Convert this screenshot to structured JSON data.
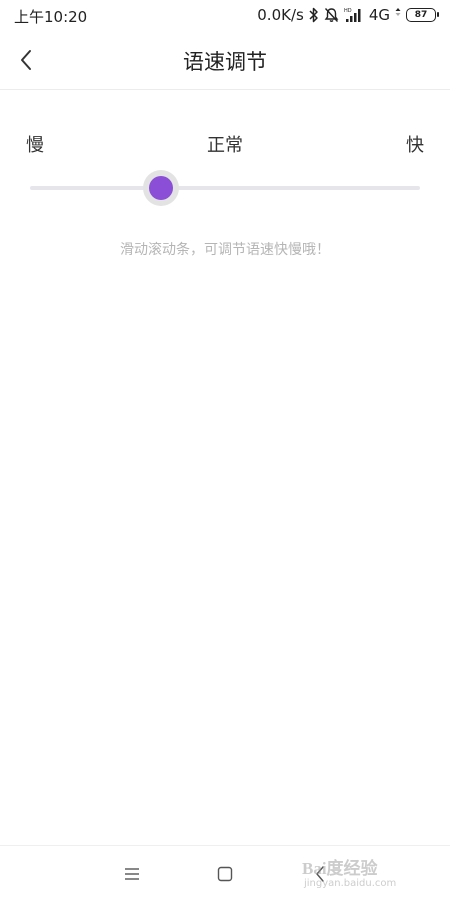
{
  "status_bar": {
    "time": "上午10:20",
    "network_speed": "0.0K/s",
    "network_type": "4G",
    "battery": "87"
  },
  "header": {
    "title": "语速调节"
  },
  "speed": {
    "slow_label": "慢",
    "normal_label": "正常",
    "fast_label": "快",
    "level_percent": 33.5,
    "accent_color": "#8a4fd6",
    "hint": "滑动滚动条，可调节语速快慢哦！"
  },
  "nav_bar": {
    "icons": [
      "menu-icon",
      "home-square-icon",
      "back-chevron-icon"
    ]
  },
  "watermark": {
    "text": "Bai度经验",
    "url": "jingyan.baidu.com"
  }
}
